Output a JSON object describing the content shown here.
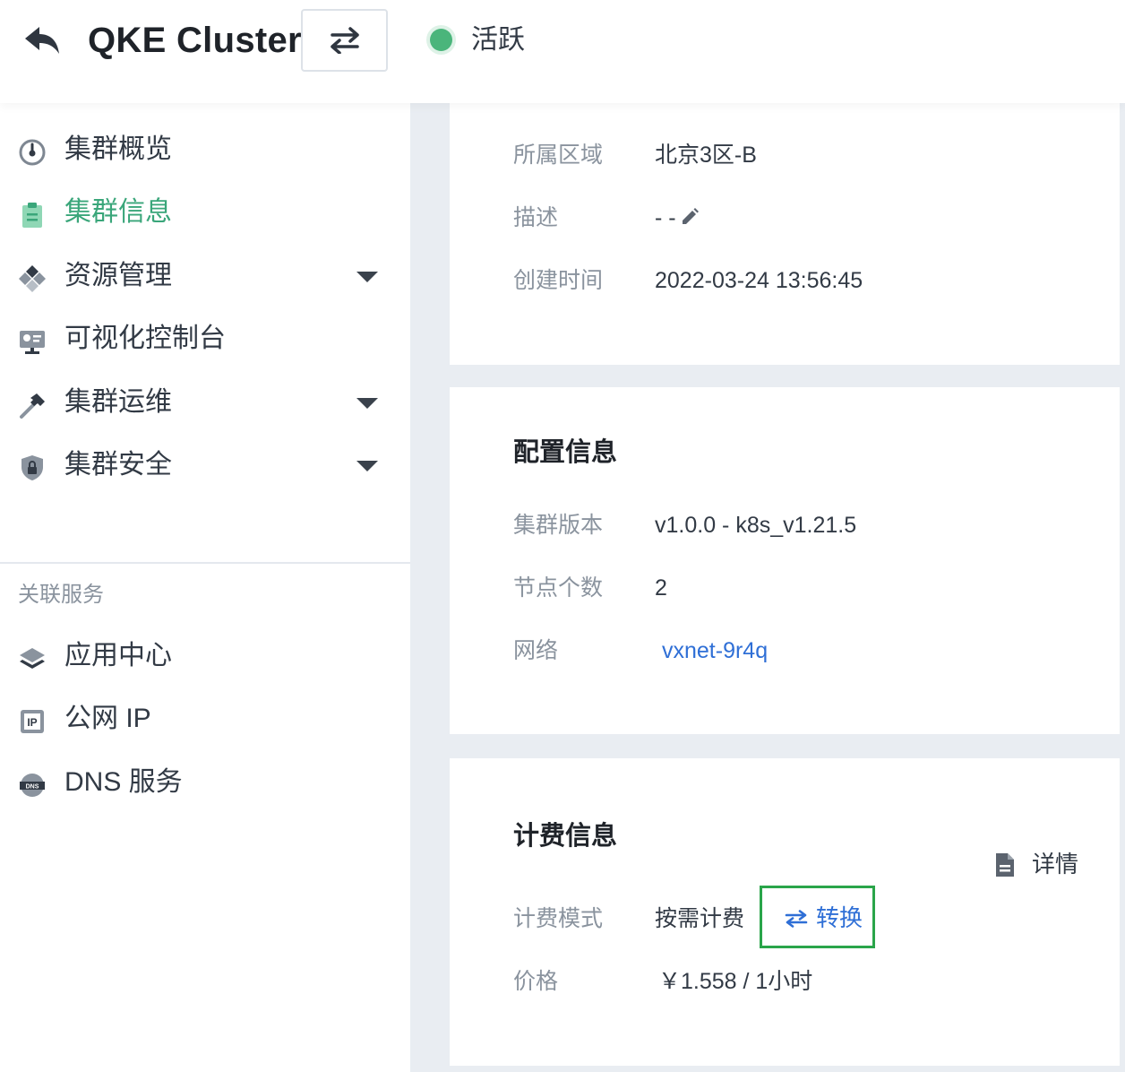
{
  "header": {
    "title": "QKE Cluster",
    "status_text": "活跃",
    "status_color": "#4ab57b"
  },
  "sidebar": {
    "items": [
      {
        "label": "集群概览",
        "icon": "gauge-icon"
      },
      {
        "label": "集群信息",
        "icon": "clipboard-icon",
        "active": true
      },
      {
        "label": "资源管理",
        "icon": "diamond-grid-icon",
        "expandable": true
      },
      {
        "label": "可视化控制台",
        "icon": "monitor-icon"
      },
      {
        "label": "集群运维",
        "icon": "hammer-icon",
        "expandable": true
      },
      {
        "label": "集群安全",
        "icon": "shield-icon",
        "expandable": true
      }
    ],
    "section_title": "关联服务",
    "related": [
      {
        "label": "应用中心",
        "icon": "layers-icon"
      },
      {
        "label": "公网 IP",
        "icon": "ip-icon"
      },
      {
        "label": "DNS 服务",
        "icon": "globe-dns-icon"
      }
    ]
  },
  "basic": {
    "region_label": "所属区域",
    "region_value": "北京3区-B",
    "desc_label": "描述",
    "desc_value": "- -",
    "created_label": "创建时间",
    "created_value": "2022-03-24 13:56:45"
  },
  "config": {
    "title": "配置信息",
    "version_label": "集群版本",
    "version_value": "v1.0.0 - k8s_v1.21.5",
    "nodes_label": "节点个数",
    "nodes_value": "2",
    "network_label": "网络",
    "network_value": "vxnet-9r4q"
  },
  "billing": {
    "title": "计费信息",
    "details_label": "详情",
    "mode_label": "计费模式",
    "mode_value": "按需计费",
    "convert_label": "转换",
    "price_label": "价格",
    "price_value": "￥1.558 / 1小时"
  },
  "colors": {
    "accent_green": "#3aa67a",
    "link_blue": "#2f6fd6",
    "highlight_border": "#2aa54a"
  }
}
